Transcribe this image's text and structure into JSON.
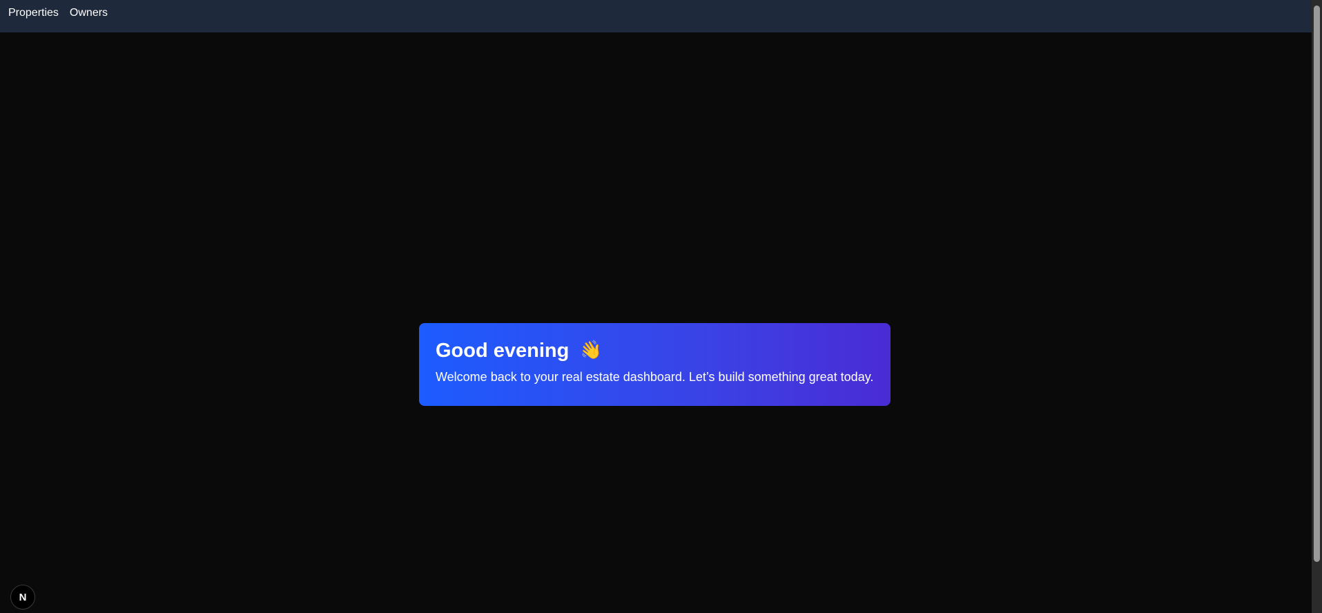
{
  "nav": {
    "items": [
      {
        "label": "Properties"
      },
      {
        "label": "Owners"
      }
    ]
  },
  "welcome": {
    "title": "Good evening",
    "wave_icon": "👋",
    "subtitle": "Welcome back to your real estate dashboard. Let’s build something great today."
  },
  "badge": {
    "letter": "N",
    "icon": "nextjs-logo-icon"
  },
  "colors": {
    "background": "#0a0a0a",
    "nav_background": "#1e293b",
    "card_gradient_start": "#1d5cff",
    "card_gradient_end": "#4a2bd4"
  }
}
